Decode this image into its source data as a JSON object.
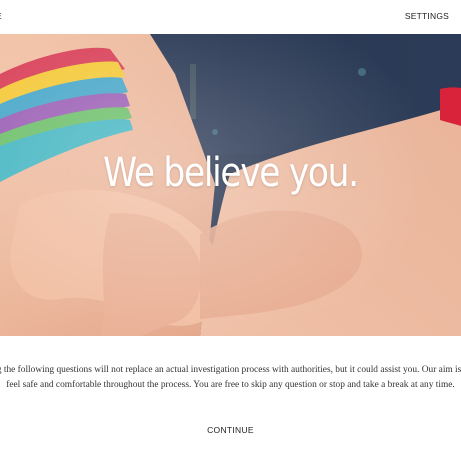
{
  "header": {
    "left_nav_label": "E",
    "settings_label": "SETTINGS"
  },
  "hero": {
    "title": "We believe you."
  },
  "intro": {
    "text": "Answering the following questions will not replace an actual investigation process with authorities, but it could assist you. Our aim is for you to feel safe and comfortable throughout the process. You are free to skip any question or stop and take a break at any time."
  },
  "actions": {
    "continue_label": "CONTINUE"
  }
}
